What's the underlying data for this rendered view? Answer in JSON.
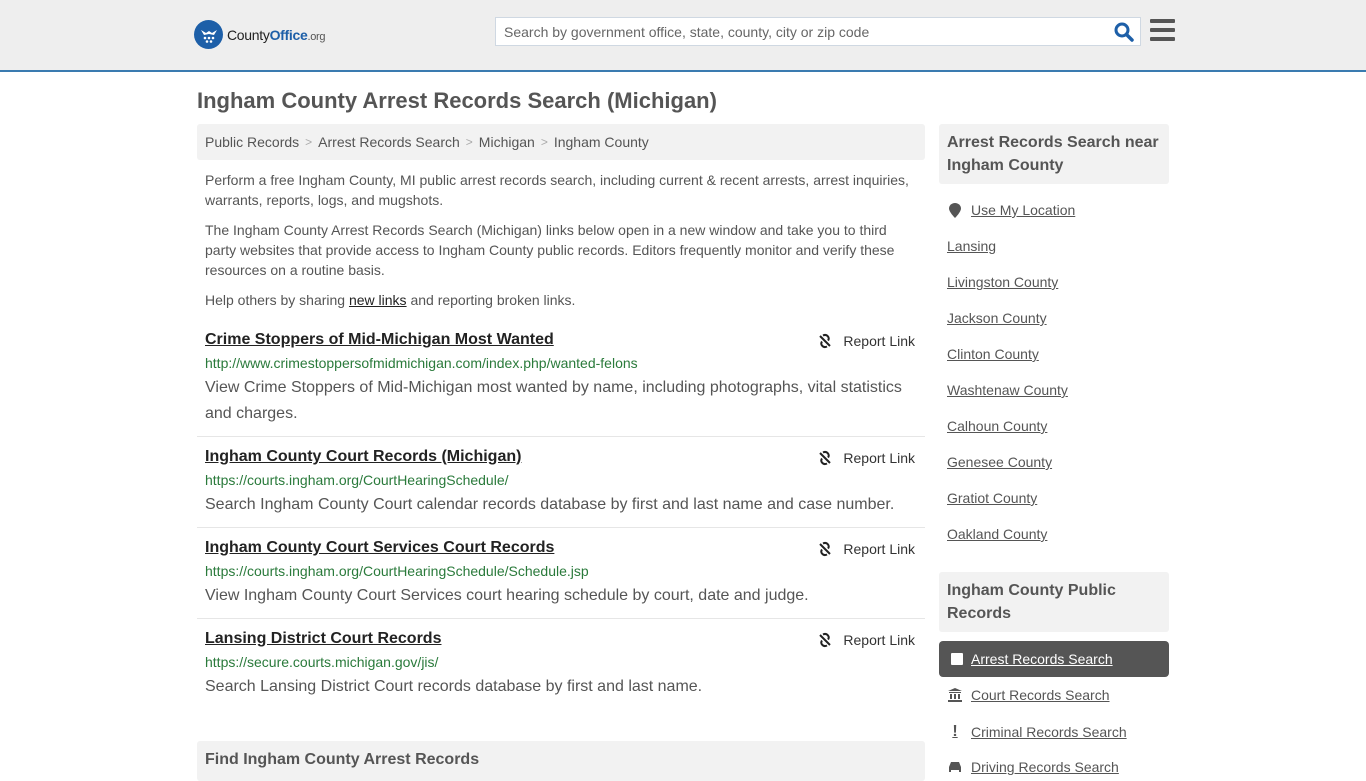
{
  "header": {
    "logo": {
      "county": "County",
      "office": "Office",
      "org": ".org"
    },
    "search_placeholder": "Search by government office, state, county, city or zip code",
    "search_icon": "search-icon",
    "menu_icon": "hamburger-menu-icon",
    "accent_color": "#3a7bb0"
  },
  "page_title": "Ingham County Arrest Records Search (Michigan)",
  "breadcrumb": [
    "Public Records",
    "Arrest Records Search",
    "Michigan",
    "Ingham County"
  ],
  "intro": {
    "p1": "Perform a free Ingham County, MI public arrest records search, including current & recent arrests, arrest inquiries, warrants, reports, logs, and mugshots.",
    "p2": "The Ingham County Arrest Records Search (Michigan) links below open in a new window and take you to third party websites that provide access to Ingham County public records. Editors frequently monitor and verify these resources on a routine basis.",
    "p3_before": "Help others by sharing ",
    "p3_link": "new links",
    "p3_after": " and reporting broken links."
  },
  "results": [
    {
      "title": "Crime Stoppers of Mid-Michigan Most Wanted",
      "url": "http://www.crimestoppersofmidmichigan.com/index.php/wanted-felons",
      "description": "View Crime Stoppers of Mid-Michigan most wanted by name, including photographs, vital statistics and charges.",
      "report_label": "Report Link"
    },
    {
      "title": "Ingham County Court Records (Michigan)",
      "url": "https://courts.ingham.org/CourtHearingSchedule/",
      "description": "Search Ingham County Court calendar records database by first and last name and case number.",
      "report_label": "Report Link"
    },
    {
      "title": "Ingham County Court Services Court Records",
      "url": "https://courts.ingham.org/CourtHearingSchedule/Schedule.jsp",
      "description": "View Ingham County Court Services court hearing schedule by court, date and judge.",
      "report_label": "Report Link"
    },
    {
      "title": "Lansing District Court Records",
      "url": "https://secure.courts.michigan.gov/jis/",
      "description": "Search Lansing District Court records database by first and last name.",
      "report_label": "Report Link"
    }
  ],
  "find_box_title": "Find Ingham County Arrest Records",
  "sidebar": {
    "nearby_title": "Arrest Records Search near Ingham County",
    "use_location": "Use My Location",
    "nearby": [
      "Lansing",
      "Livingston County",
      "Jackson County",
      "Clinton County",
      "Washtenaw County",
      "Calhoun County",
      "Genesee County",
      "Gratiot County",
      "Oakland County"
    ],
    "public_records_title": "Ingham County Public Records",
    "public_records": [
      {
        "label": "Arrest Records Search",
        "icon": "square-icon",
        "active": true
      },
      {
        "label": "Court Records Search",
        "icon": "courthouse-icon",
        "active": false
      },
      {
        "label": "Criminal Records Search",
        "icon": "exclamation-icon",
        "active": false
      },
      {
        "label": "Driving Records Search",
        "icon": "car-icon",
        "active": false
      }
    ]
  }
}
